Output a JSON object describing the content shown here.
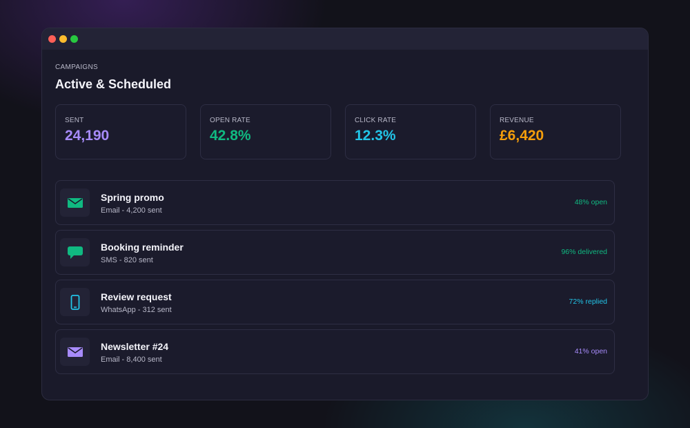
{
  "header": {
    "eyebrow": "CAMPAIGNS",
    "title": "Active & Scheduled"
  },
  "stats": [
    {
      "label": "SENT",
      "value": "24,190",
      "color": "#a78bfa"
    },
    {
      "label": "OPEN RATE",
      "value": "42.8%",
      "color": "#10b981"
    },
    {
      "label": "CLICK RATE",
      "value": "12.3%",
      "color": "#22c5e8"
    },
    {
      "label": "REVENUE",
      "value": "£6,420",
      "color": "#f59e0b"
    }
  ],
  "campaigns": [
    {
      "title": "Spring promo",
      "subtitle": "Email - 4,200 sent",
      "metric": "48% open",
      "icon": "envelope-icon",
      "color": "#10b981"
    },
    {
      "title": "Booking reminder",
      "subtitle": "SMS - 820 sent",
      "metric": "96% delivered",
      "icon": "chat-bubble-icon",
      "color": "#10b981"
    },
    {
      "title": "Review request",
      "subtitle": "WhatsApp - 312 sent",
      "metric": "72% replied",
      "icon": "phone-icon",
      "color": "#22c5e8"
    },
    {
      "title": "Newsletter #24",
      "subtitle": "Email - 8,400 sent",
      "metric": "41% open",
      "icon": "envelope-icon",
      "color": "#a78bfa"
    }
  ]
}
